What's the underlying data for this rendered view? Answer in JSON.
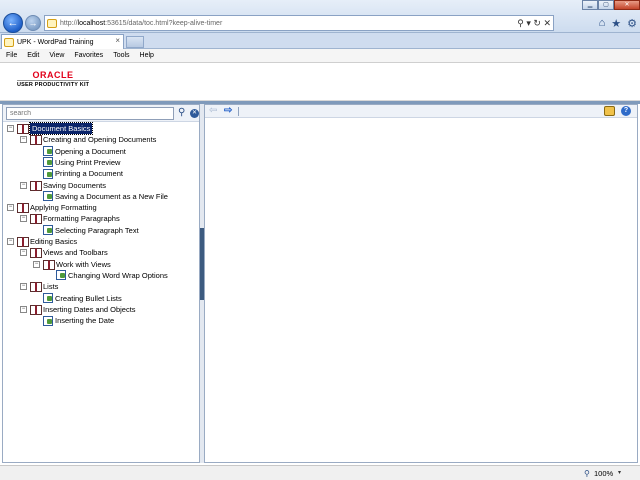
{
  "browser": {
    "url_prefix": "http://",
    "url_host": "localhost",
    "url_rest": ":53615/data/toc.html?keep-alive-timer",
    "addr_actions": "⚲ ▾ ↻ ✕",
    "tab_title": "UPK - WordPad Training",
    "tab_close": "×",
    "menu": [
      "File",
      "Edit",
      "View",
      "Favorites",
      "Tools",
      "Help"
    ],
    "window_controls": {
      "minimize": "▁",
      "maximize": "▢",
      "close": "✕"
    },
    "tool_icons": {
      "home": "⌂",
      "favorites": "★",
      "settings": "⚙"
    },
    "nav": {
      "back": "←",
      "forward": "→"
    }
  },
  "header": {
    "oracle": "ORACLE",
    "product": "USER PRODUCTIVITY KIT"
  },
  "toc": {
    "search_placeholder": "search",
    "search_icon": "⚲",
    "clear_icon": "✕",
    "nodes": [
      {
        "label": "Document Basics",
        "type": "book",
        "level": 0,
        "expander": "−",
        "selected": true
      },
      {
        "label": "Creating and Opening Documents",
        "type": "book",
        "level": 1,
        "expander": "−"
      },
      {
        "label": "Opening a Document",
        "type": "topic",
        "level": 2
      },
      {
        "label": "Using Print Preview",
        "type": "topic",
        "level": 2
      },
      {
        "label": "Printing a Document",
        "type": "topic",
        "level": 2
      },
      {
        "label": "Saving Documents",
        "type": "book",
        "level": 1,
        "expander": "−"
      },
      {
        "label": "Saving a Document as a New File",
        "type": "topic",
        "level": 2
      },
      {
        "label": "Applying Formatting",
        "type": "book",
        "level": 0,
        "expander": "−"
      },
      {
        "label": "Formatting Paragraphs",
        "type": "book",
        "level": 1,
        "expander": "−"
      },
      {
        "label": "Selecting Paragraph Text",
        "type": "topic",
        "level": 2
      },
      {
        "label": "Editing Basics",
        "type": "book",
        "level": 0,
        "expander": "−"
      },
      {
        "label": "Views and Toolbars",
        "type": "book",
        "level": 1,
        "expander": "−"
      },
      {
        "label": "Work with Views",
        "type": "book",
        "level": 2,
        "expander": "−"
      },
      {
        "label": "Changing Word Wrap Options",
        "type": "topic",
        "level": 3
      },
      {
        "label": "Lists",
        "type": "book",
        "level": 1,
        "expander": "−"
      },
      {
        "label": "Creating Bullet Lists",
        "type": "topic",
        "level": 2
      },
      {
        "label": "Inserting Dates and Objects",
        "type": "book",
        "level": 1,
        "expander": "−"
      },
      {
        "label": "Inserting the Date",
        "type": "topic",
        "level": 2
      }
    ]
  },
  "content_toolbar": {
    "back_icon": "⇦",
    "forward_icon": "⇨",
    "help_icon": "?"
  },
  "status": {
    "zoom": "100%",
    "zoom_icon": "⚲",
    "zoom_caret": "▾"
  }
}
